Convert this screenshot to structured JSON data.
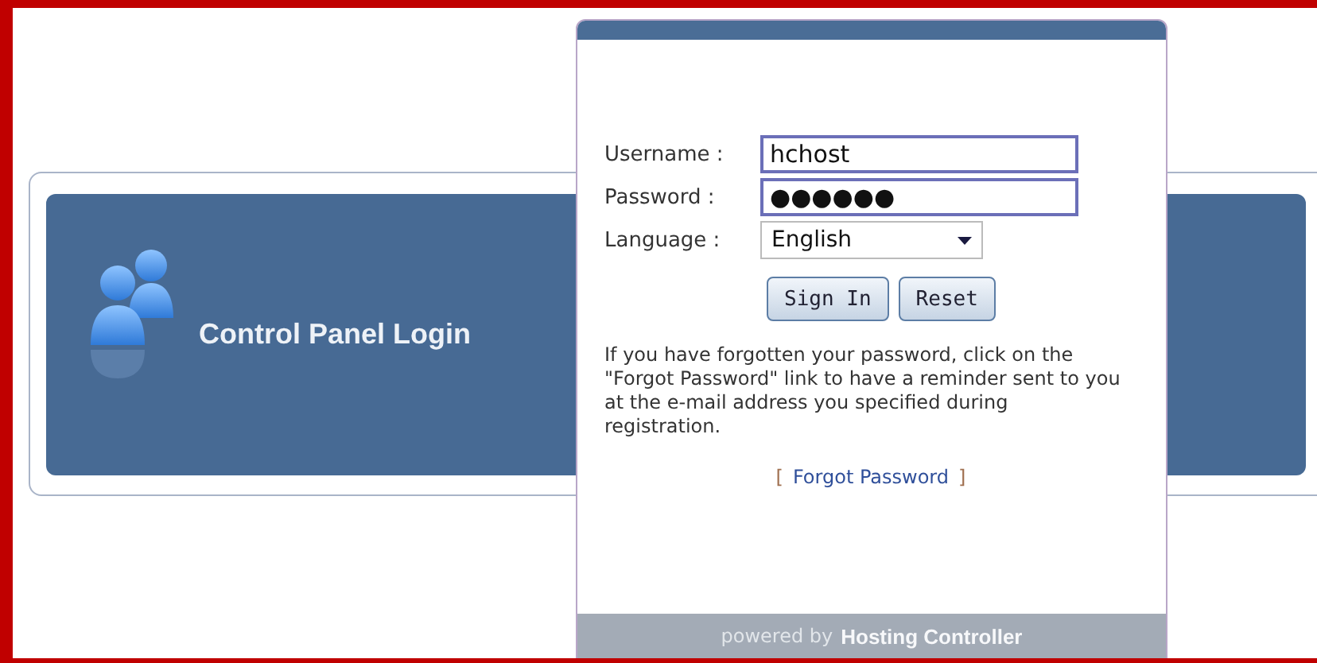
{
  "banner": {
    "title": "Control Panel Login"
  },
  "login": {
    "fields": [
      {
        "kind": "text",
        "label": "Username :",
        "value": "hchost"
      },
      {
        "kind": "text",
        "label": "Password :",
        "value": "●●●●●●"
      },
      {
        "kind": "select",
        "label": "Language :",
        "value": "English"
      }
    ],
    "buttons": [
      "Sign In",
      "Reset"
    ],
    "help_text": "If you have forgotten your password, click on the \"Forgot Password\" link to have a reminder sent to you at the e-mail address you specified during registration.",
    "link": {
      "open": "[",
      "label": "Forgot Password",
      "close": "]"
    },
    "footer": {
      "prefix": "powered by",
      "brand": "Hosting Controller"
    }
  }
}
